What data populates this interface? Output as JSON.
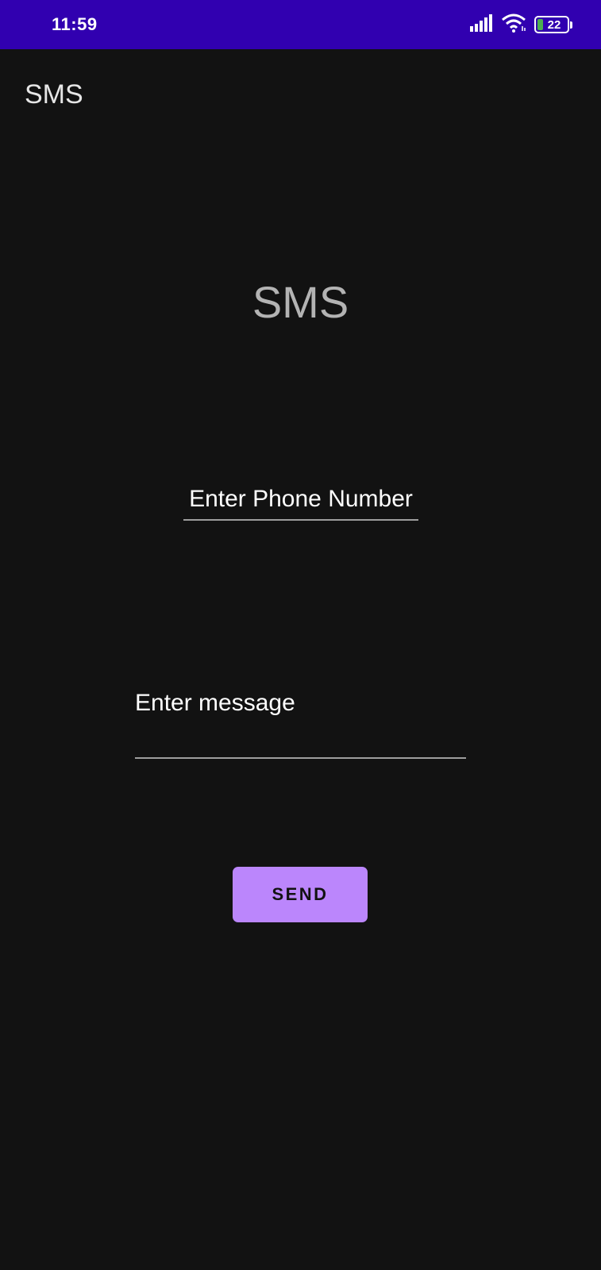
{
  "status_bar": {
    "time": "11:59",
    "battery_level": "22",
    "icons": [
      "signal-icon",
      "wifi-icon",
      "battery-icon"
    ],
    "background_color": "#3100b0"
  },
  "app_bar": {
    "title": "SMS"
  },
  "main": {
    "heading": "SMS",
    "phone_placeholder": "Enter Phone Number",
    "phone_value": "",
    "message_placeholder": "Enter message",
    "message_value": "",
    "send_label": "SEND"
  },
  "colors": {
    "background": "#121212",
    "accent": "#bb86fc",
    "status_bar": "#3100b0"
  }
}
